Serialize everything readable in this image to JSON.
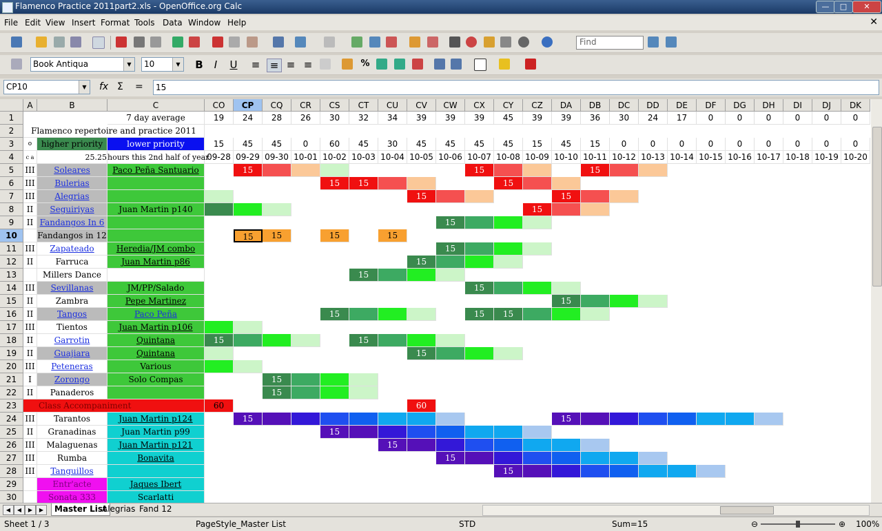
{
  "window": {
    "title": "Flamenco Practice 2011part2.xls - OpenOffice.org Calc"
  },
  "menu": [
    "File",
    "Edit",
    "View",
    "Insert",
    "Format",
    "Tools",
    "Data",
    "Window",
    "Help"
  ],
  "find_placeholder": "Find",
  "font": {
    "name": "Book Antiqua",
    "size": "10"
  },
  "name_box": "CP10",
  "formula_input": "15",
  "columns_left": [
    "A",
    "B",
    "C"
  ],
  "columns_right": [
    "CO",
    "CP",
    "CQ",
    "CR",
    "CS",
    "CT",
    "CU",
    "CV",
    "CW",
    "CX",
    "CY",
    "CZ",
    "DA",
    "DB",
    "DC",
    "DD",
    "DE",
    "DF",
    "DG",
    "DH",
    "DI",
    "DJ",
    "DK"
  ],
  "selected_col": "CP",
  "selected_row": 10,
  "row1_label": "7 day average",
  "row1_values": [
    "19",
    "24",
    "28",
    "26",
    "30",
    "32",
    "34",
    "39",
    "39",
    "39",
    "45",
    "39",
    "39",
    "36",
    "30",
    "24",
    "17",
    "0",
    "0",
    "0",
    "0",
    "0",
    "0"
  ],
  "row2_label": "Flamenco repertoire and practice 2011",
  "row3": {
    "a": "o",
    "b": "higher priority",
    "c": "lower priority"
  },
  "row3_values": [
    "15",
    "45",
    "45",
    "0",
    "60",
    "45",
    "30",
    "45",
    "45",
    "45",
    "45",
    "15",
    "45",
    "15",
    "0",
    "0",
    "0",
    "0",
    "0",
    "0",
    "0",
    "0",
    "0"
  ],
  "row4": {
    "a": "c a",
    "b": "25.25",
    "c": "hours this 2nd half of year"
  },
  "row4_dates": [
    "09-28",
    "09-29",
    "09-30",
    "10-01",
    "10-02",
    "10-03",
    "10-04",
    "10-05",
    "10-06",
    "10-07",
    "10-08",
    "10-09",
    "10-10",
    "10-11",
    "10-12",
    "10-13",
    "10-14",
    "10-15",
    "10-16",
    "10-17",
    "10-18",
    "10-19",
    "10-20"
  ],
  "rows": [
    {
      "n": 5,
      "a": "III",
      "b": "Soleares",
      "c": "Paco Peña Santuario"
    },
    {
      "n": 6,
      "a": "III",
      "b": "Bulerias",
      "c": ""
    },
    {
      "n": 7,
      "a": "III",
      "b": "Alegrias",
      "c": ""
    },
    {
      "n": 8,
      "a": "II",
      "b": "Seguiriyas",
      "c": "Juan Martin p140"
    },
    {
      "n": 9,
      "a": "II",
      "b": "Fandangos In 6",
      "c": ""
    },
    {
      "n": 10,
      "a": "",
      "b": "Fandangos in 12",
      "c": ""
    },
    {
      "n": 11,
      "a": "III",
      "b": "Zapateado",
      "c": "Heredia/JM combo"
    },
    {
      "n": 12,
      "a": "II",
      "b": "Farruca",
      "c": "Juan Martin p86"
    },
    {
      "n": 13,
      "a": "",
      "b": "Millers Dance",
      "c": ""
    },
    {
      "n": 14,
      "a": "III",
      "b": "Sevillanas",
      "c": "JM/PP/Salado"
    },
    {
      "n": 15,
      "a": "II",
      "b": "Zambra",
      "c": "Pepe Martinez"
    },
    {
      "n": 16,
      "a": "II",
      "b": "Tangos",
      "c": "Paco Peña"
    },
    {
      "n": 17,
      "a": "III",
      "b": "Tientos",
      "c": "Juan Martin p106"
    },
    {
      "n": 18,
      "a": "II",
      "b": "Garrotin",
      "c": "Quintana"
    },
    {
      "n": 19,
      "a": "II",
      "b": "Guajiara",
      "c": "Quintana"
    },
    {
      "n": 20,
      "a": "III",
      "b": "Peteneras",
      "c": "Various"
    },
    {
      "n": 21,
      "a": "I",
      "b": "Zorongo",
      "c": "Solo Compas"
    },
    {
      "n": 22,
      "a": "II",
      "b": "Panaderos",
      "c": ""
    },
    {
      "n": 23,
      "a": "",
      "b": "Class Accompaniment",
      "c": ""
    },
    {
      "n": 24,
      "a": "III",
      "b": "Tarantos",
      "c": "Juan Martin p124"
    },
    {
      "n": 25,
      "a": "II",
      "b": "Granadinas",
      "c": "Juan Martin p99"
    },
    {
      "n": 26,
      "a": "III",
      "b": "Malaguenas",
      "c": "Juan Martin p121"
    },
    {
      "n": 27,
      "a": "III",
      "b": "Rumba",
      "c": "Bonavita"
    },
    {
      "n": 28,
      "a": "III",
      "b": "Tanguillos",
      "c": ""
    },
    {
      "n": 29,
      "a": "",
      "b": "Entr'acte",
      "c": "Jaques Ibert"
    },
    {
      "n": 30,
      "a": "",
      "b": "Sonata 333",
      "c": "Scarlatti"
    }
  ],
  "heat_value": "15",
  "sixty_value": "60",
  "sheets": [
    "Master List",
    "Alegrias",
    "Fand 12"
  ],
  "status": {
    "sheet": "Sheet 1 / 3",
    "pagestyle": "PageStyle_Master List",
    "mode": "STD",
    "sum": "Sum=15",
    "zoom": "100%"
  }
}
